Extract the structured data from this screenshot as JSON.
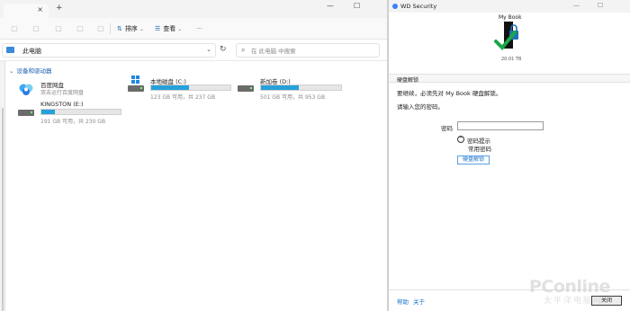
{
  "explorer": {
    "tab": {
      "close_glyph": "×"
    },
    "new_tab_glyph": "+",
    "window_controls": {
      "minimize": "—",
      "maximize": "☐"
    },
    "toolbar": {
      "sort_label": "排序",
      "view_label": "查看",
      "more_glyph": "···"
    },
    "address": {
      "path": "此电脑",
      "dropdown_glyph": "⌄"
    },
    "refresh_glyph": "↻",
    "search": {
      "placeholder": "在 此电脑 中搜索"
    },
    "section_title": "设备和驱动器",
    "drives": [
      {
        "name": "百度网盘",
        "sub": "双击运行百度网盘",
        "icon": "cloud-icon"
      },
      {
        "name": "本地磁盘 (C:)",
        "sub": "123 GB 可用，共 237 GB",
        "used_fraction": 0.48,
        "icon": "hard-drive-icon"
      },
      {
        "name": "新加卷 (D:)",
        "sub": "501 GB 可用，共 953 GB",
        "used_fraction": 0.47,
        "icon": "hard-drive-icon"
      },
      {
        "name": "KINGSTON (E:)",
        "sub": "191 GB 可用，共 230 GB",
        "used_fraction": 0.17,
        "icon": "usb-drive-icon"
      }
    ]
  },
  "wd": {
    "title": "WD Security",
    "window_controls": {
      "minimize": "—",
      "maximize": "☐"
    },
    "device_name": "My Book",
    "device_capacity": "20.01 TB",
    "header": "硬盘解锁",
    "message1": "要继续，必须先对 My Book 硬盘解锁。",
    "message2": "请输入您的密码。",
    "password_label": "密码",
    "password_value": "",
    "hint_icon_glyph": "^",
    "hint_label": "密码提示",
    "hint_value": "常用密码",
    "unlock_button": "硬盘解锁",
    "help_link": "帮助",
    "about_link": "关于",
    "close_button": "关闭"
  },
  "watermark": {
    "main": "PConline",
    "sub": "太平洋电脑网"
  },
  "colors": {
    "accent": "#26a0da",
    "link": "#1a73c9",
    "check": "#1aa84a"
  }
}
